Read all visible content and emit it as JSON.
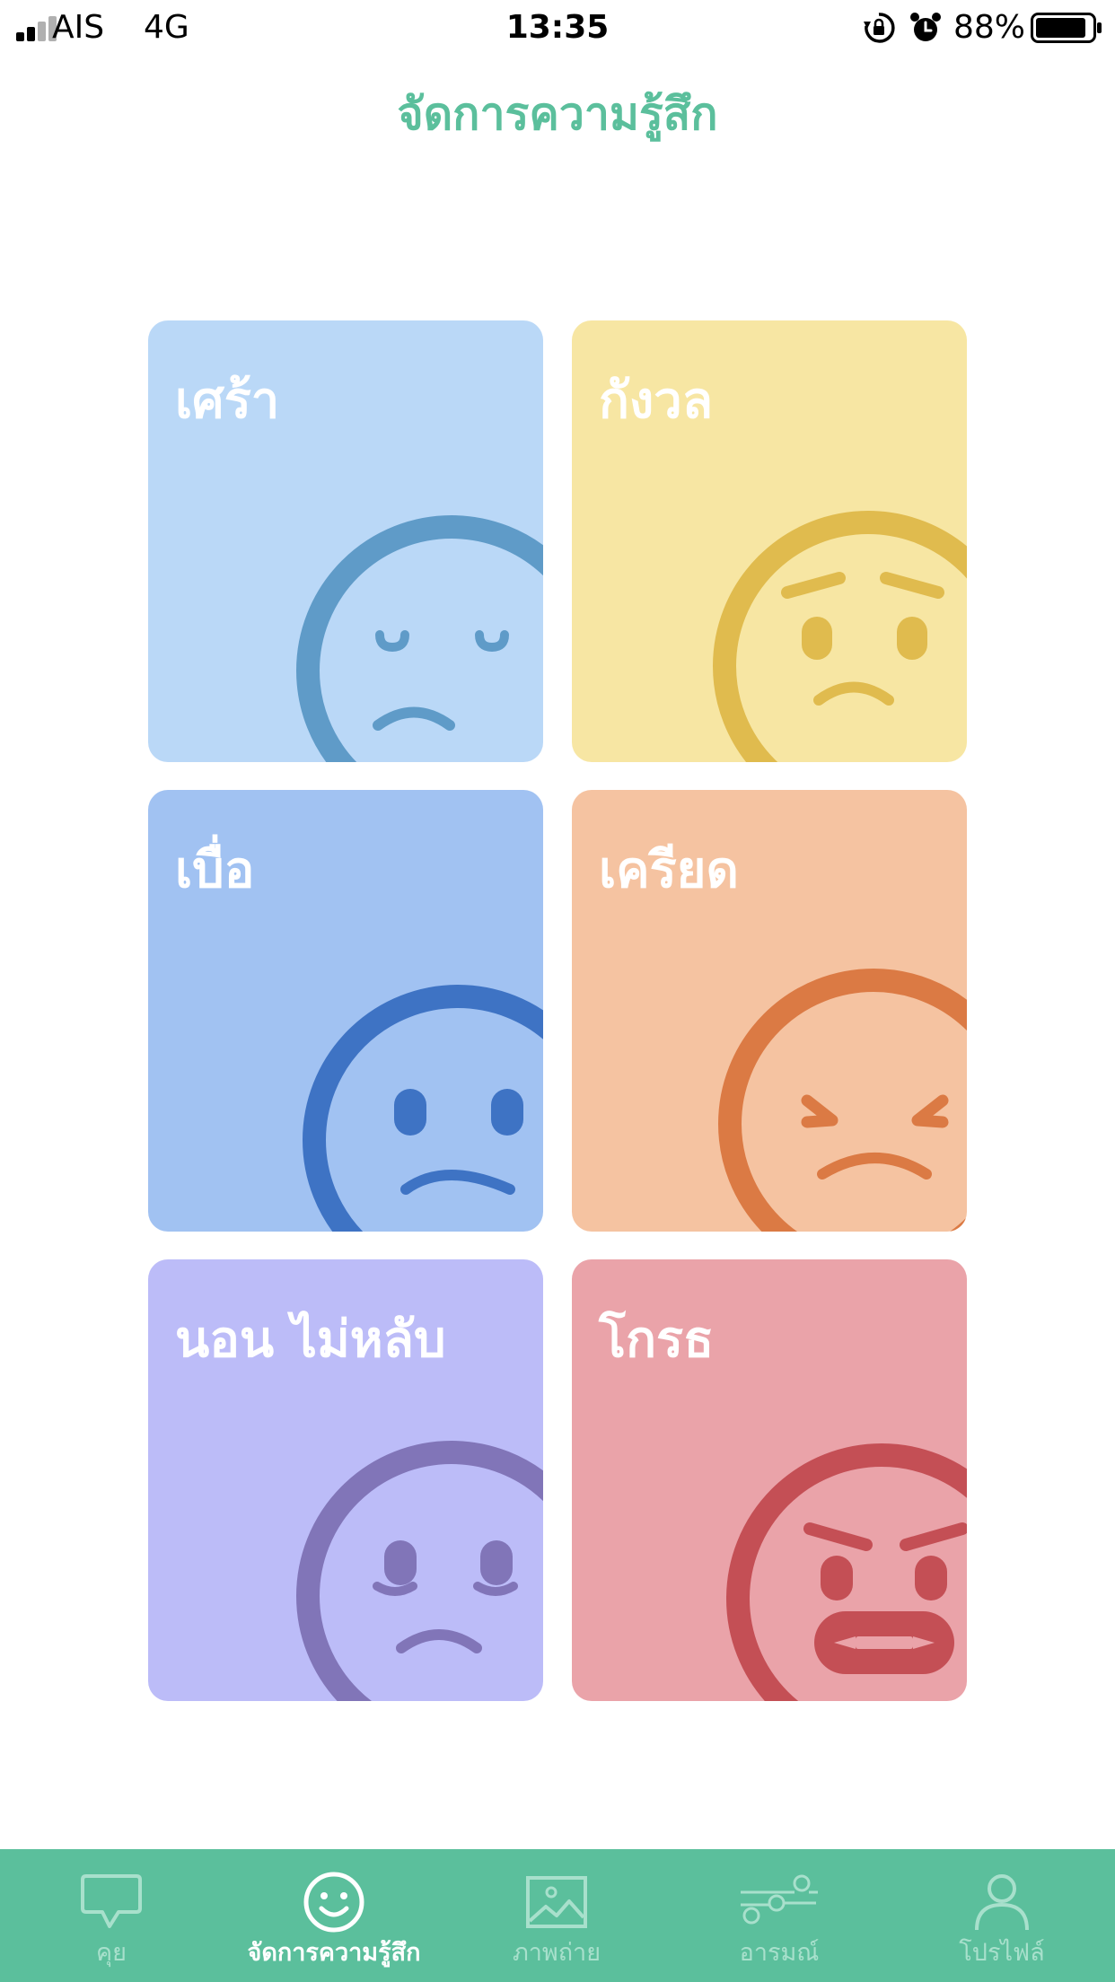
{
  "status_bar": {
    "carrier": "AIS",
    "network": "4G",
    "time": "13:35",
    "battery_percent": "88%"
  },
  "header": {
    "title": "จัดการความรู้สึก"
  },
  "emotions": [
    {
      "label": "เศร้า",
      "bg": "#bad8f7",
      "accent": "#5f9bc8",
      "icon": "sad-face-icon"
    },
    {
      "label": "กังวล",
      "bg": "#f7e6a3",
      "accent": "#e0bb4e",
      "icon": "worried-face-icon"
    },
    {
      "label": "เบื่อ",
      "bg": "#a1c2f2",
      "accent": "#3e73c4",
      "icon": "bored-face-icon"
    },
    {
      "label": "เครียด",
      "bg": "#f5c3a1",
      "accent": "#db7a44",
      "icon": "stressed-face-icon"
    },
    {
      "label": "นอน ไม่หลับ",
      "bg": "#bcbcf8",
      "accent": "#8175b8",
      "icon": "sleepless-face-icon"
    },
    {
      "label": "โกรธ",
      "bg": "#eaa3a9",
      "accent": "#c44f55",
      "icon": "angry-face-icon"
    }
  ],
  "tab_bar": {
    "active_index": 1,
    "tabs": [
      {
        "label": "คุย",
        "icon": "chat-bubble-icon"
      },
      {
        "label": "จัดการความรู้สึก",
        "icon": "smile-icon"
      },
      {
        "label": "ภาพถ่าย",
        "icon": "photo-icon"
      },
      {
        "label": "อารมณ์",
        "icon": "mood-chart-icon"
      },
      {
        "label": "โปรไฟล์",
        "icon": "profile-icon"
      }
    ]
  },
  "colors": {
    "brand": "#5bbf9c",
    "tab_inactive": "#a8e0cc"
  }
}
